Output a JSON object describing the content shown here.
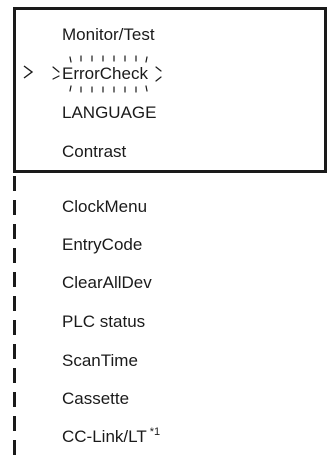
{
  "menu": {
    "screen_items": [
      {
        "label": "Monitor/Test"
      },
      {
        "label": "ErrorCheck"
      },
      {
        "label": "LANGUAGE"
      },
      {
        "label": "Contrast"
      }
    ],
    "selected_index": 1,
    "selected_state": "blinking",
    "scroll_items": [
      {
        "label": "ClockMenu"
      },
      {
        "label": "EntryCode"
      },
      {
        "label": "ClearAllDev"
      },
      {
        "label": "PLC status"
      },
      {
        "label": "ScanTime"
      },
      {
        "label": "Cassette"
      },
      {
        "label": "CC-Link/LT",
        "note": "*1"
      }
    ]
  },
  "icons": {
    "cursor": "chevron-right-icon",
    "blink": "blink-indicator-icon"
  },
  "colors": {
    "line": "#1a1a1a",
    "text": "#1a1a1a",
    "background": "#ffffff"
  }
}
